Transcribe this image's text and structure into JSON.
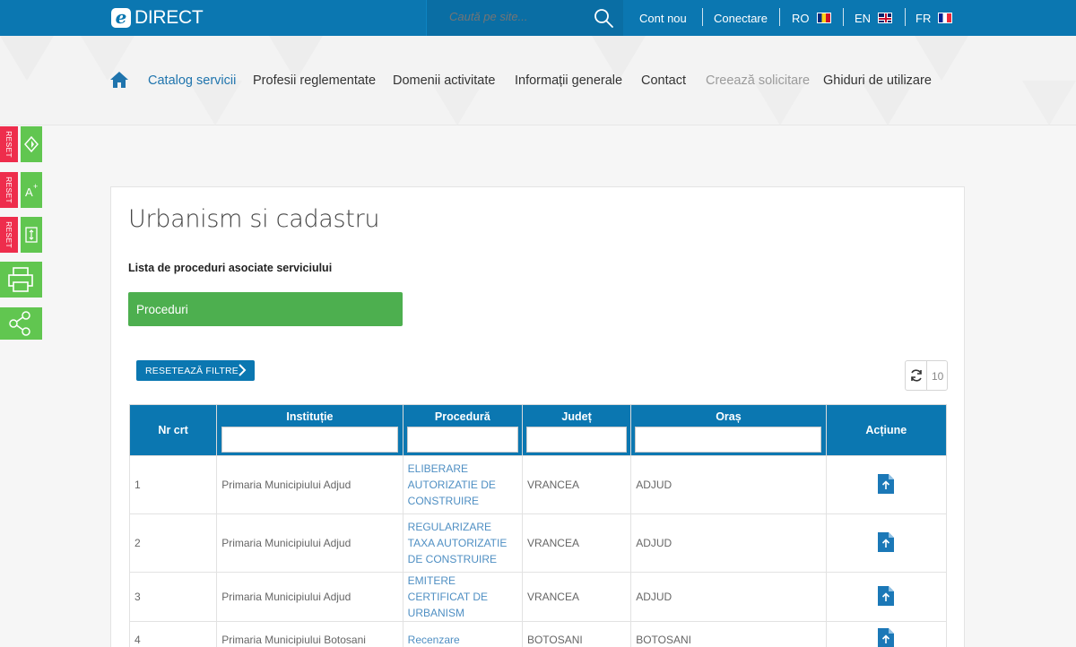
{
  "header": {
    "logo_letter": "e",
    "logo_text": "DIRECT",
    "search_placeholder": "Caută pe site...",
    "links": [
      {
        "label": "Cont nou"
      },
      {
        "label": "Conectare"
      }
    ],
    "languages": [
      {
        "code": "RO",
        "flag": "ro-flag-icon"
      },
      {
        "code": "EN",
        "flag": "uk-flag-icon"
      },
      {
        "code": "FR",
        "flag": "fr-flag-icon"
      }
    ],
    "bar_color": "#0b77b1"
  },
  "nav": {
    "items": [
      {
        "label": "Catalog servicii",
        "state": "active"
      },
      {
        "label": "Profesii reglementate",
        "state": "normal"
      },
      {
        "label": "Domenii activitate",
        "state": "normal"
      },
      {
        "label": "Informații generale",
        "state": "normal"
      },
      {
        "label": "Contact",
        "state": "normal"
      },
      {
        "label": "Creează solicitare",
        "state": "disabled"
      },
      {
        "label": "Ghiduri de utilizare",
        "state": "normal"
      }
    ]
  },
  "side_tools": {
    "reset_label": "RESET",
    "tools": [
      "contrast-icon",
      "font-size-icon",
      "line-height-icon",
      "print-icon",
      "share-icon"
    ]
  },
  "content": {
    "title": "Urbanism si cadastru",
    "subtitle": "Lista de proceduri asociate serviciului",
    "tab_label": "Proceduri",
    "reset_filters_label": "RESETEAZĂ FILTRE",
    "page_size": "10",
    "accent_green": "#4daf4f"
  },
  "table": {
    "columns": [
      "Nr crt",
      "Instituție",
      "Procedură",
      "Județ",
      "Oraș",
      "Acțiune"
    ],
    "rows": [
      {
        "nr": "1",
        "institutie": "Primaria Municipiului Adjud",
        "procedura": "ELIBERARE AUTORIZATIE DE CONSTRUIRE",
        "judet": "VRANCEA",
        "oras": "ADJUD"
      },
      {
        "nr": "2",
        "institutie": "Primaria Municipiului Adjud",
        "procedura": "REGULARIZARE TAXA AUTORIZATIE DE CONSTRUIRE",
        "judet": "VRANCEA",
        "oras": "ADJUD"
      },
      {
        "nr": "3",
        "institutie": "Primaria Municipiului Adjud",
        "procedura": "EMITERE CERTIFICAT DE URBANISM",
        "judet": "VRANCEA",
        "oras": "ADJUD"
      },
      {
        "nr": "4",
        "institutie": "Primaria Municipiului Botosani",
        "procedura": "Recenzare",
        "judet": "BOTOSANI",
        "oras": "BOTOSANI"
      }
    ]
  }
}
